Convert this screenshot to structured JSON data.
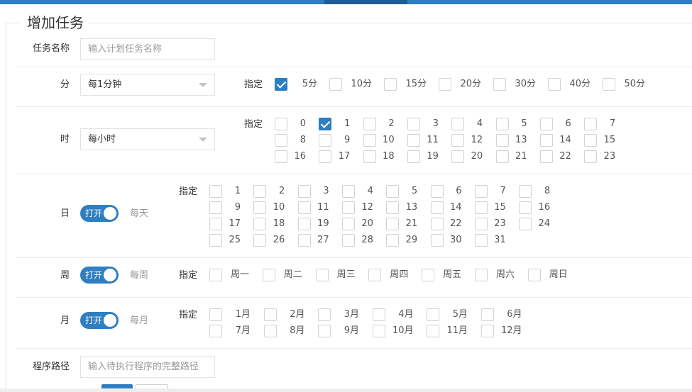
{
  "legend": "增加任务",
  "task_name": {
    "label": "任务名称",
    "placeholder": "输入计划任务名称"
  },
  "zhiding": "指定",
  "minute": {
    "label": "分",
    "select_value": "每1分钟",
    "options": [
      {
        "text": "5分",
        "checked": true
      },
      {
        "text": "10分",
        "checked": false
      },
      {
        "text": "15分",
        "checked": false
      },
      {
        "text": "20分",
        "checked": false
      },
      {
        "text": "30分",
        "checked": false
      },
      {
        "text": "40分",
        "checked": false
      },
      {
        "text": "50分",
        "checked": false
      }
    ]
  },
  "hour": {
    "label": "时",
    "select_value": "每小时",
    "options": [
      "0",
      "1",
      "2",
      "3",
      "4",
      "5",
      "6",
      "7",
      "8",
      "9",
      "10",
      "11",
      "12",
      "13",
      "14",
      "15",
      "16",
      "17",
      "18",
      "19",
      "20",
      "21",
      "22",
      "23"
    ],
    "checked": [
      "1"
    ]
  },
  "day": {
    "label": "日",
    "switch_text": "打开",
    "switch_caption": "每天",
    "switch_on": true,
    "options": [
      "1",
      "2",
      "3",
      "4",
      "5",
      "6",
      "7",
      "8",
      "9",
      "10",
      "11",
      "12",
      "13",
      "14",
      "15",
      "16",
      "17",
      "18",
      "19",
      "20",
      "21",
      "22",
      "23",
      "24",
      "25",
      "26",
      "27",
      "28",
      "29",
      "30",
      "31"
    ]
  },
  "week": {
    "label": "周",
    "switch_text": "打开",
    "switch_caption": "每周",
    "switch_on": true,
    "options": [
      "周一",
      "周二",
      "周三",
      "周四",
      "周五",
      "周六",
      "周日"
    ]
  },
  "month": {
    "label": "月",
    "switch_text": "打开",
    "switch_caption": "每月",
    "switch_on": true,
    "options": [
      "1月",
      "2月",
      "3月",
      "4月",
      "5月",
      "6月",
      "7月",
      "8月",
      "9月",
      "10月",
      "11月",
      "12月"
    ]
  },
  "program_path": {
    "label": "程序路径",
    "placeholder": "输入待执行程序的完整路径"
  },
  "colors": {
    "primary": "#2e7ec2",
    "border": "#e2e2e2",
    "muted": "#999999"
  }
}
